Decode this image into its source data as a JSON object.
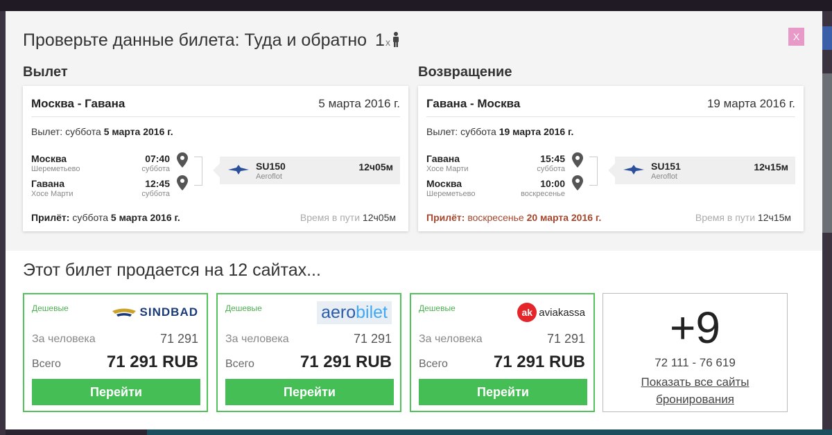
{
  "modal": {
    "title": "Проверьте данные билета: Туда и обратно",
    "passengers": "1",
    "passengers_mark": "x",
    "close_label": "X"
  },
  "outbound": {
    "section_label": "Вылет",
    "route": "Москва - Гавана",
    "date": "5 марта 2016 г.",
    "departure_label": "Вылет:",
    "departure_day": "суббота",
    "departure_date": "5 марта 2016 г.",
    "segments": [
      {
        "city": "Москва",
        "airport": "Шереметьево",
        "time": "07:40",
        "day": "суббота"
      },
      {
        "city": "Гавана",
        "airport": "Хосе Марти",
        "time": "12:45",
        "day": "суббота"
      }
    ],
    "flight_number": "SU150",
    "carrier": "Aeroflot",
    "duration": "12ч05м",
    "arrival_label": "Прилёт:",
    "arrival_day": "суббота",
    "arrival_date": "5 марта 2016 г.",
    "travel_time_label": "Время в пути",
    "travel_time": "12ч05м"
  },
  "return": {
    "section_label": "Возвращение",
    "route": "Гавана - Москва",
    "date": "19 марта 2016 г.",
    "departure_label": "Вылет:",
    "departure_day": "суббота",
    "departure_date": "19 марта 2016 г.",
    "segments": [
      {
        "city": "Гавана",
        "airport": "Хосе Марти",
        "time": "15:45",
        "day": "суббота"
      },
      {
        "city": "Москва",
        "airport": "Шереметьево",
        "time": "10:00",
        "day": "воскресенье"
      }
    ],
    "flight_number": "SU151",
    "carrier": "Aeroflot",
    "duration": "12ч15м",
    "arrival_label": "Прилёт:",
    "arrival_day": "воскресенье",
    "arrival_date": "20 марта 2016 г.",
    "travel_time_label": "Время в пути",
    "travel_time": "12ч15м"
  },
  "sold_title": "Этот билет продается на 12 сайтах...",
  "offers": [
    {
      "tag": "Дешевые",
      "brand": "SINDBAD",
      "per_person_label": "За человека",
      "per_person": "71 291",
      "total_label": "Всего",
      "total": "71 291 RUB",
      "button": "Перейти"
    },
    {
      "tag": "Дешевые",
      "brand_a": "aero",
      "brand_b": "bilet",
      "per_person_label": "За человека",
      "per_person": "71 291",
      "total_label": "Всего",
      "total": "71 291 RUB",
      "button": "Перейти"
    },
    {
      "tag": "Дешевые",
      "brand_mark": "ak",
      "brand": "aviakassa",
      "per_person_label": "За человека",
      "per_person": "71 291",
      "total_label": "Всего",
      "total": "71 291 RUB",
      "button": "Перейти"
    }
  ],
  "more": {
    "count": "+9",
    "price_range": "72 111 - 76 619",
    "link": "Показать все сайты бронирования"
  },
  "colors": {
    "accent_green": "#45bf55",
    "close_pink": "#e79ac7",
    "arrival_red": "#a5452b"
  }
}
